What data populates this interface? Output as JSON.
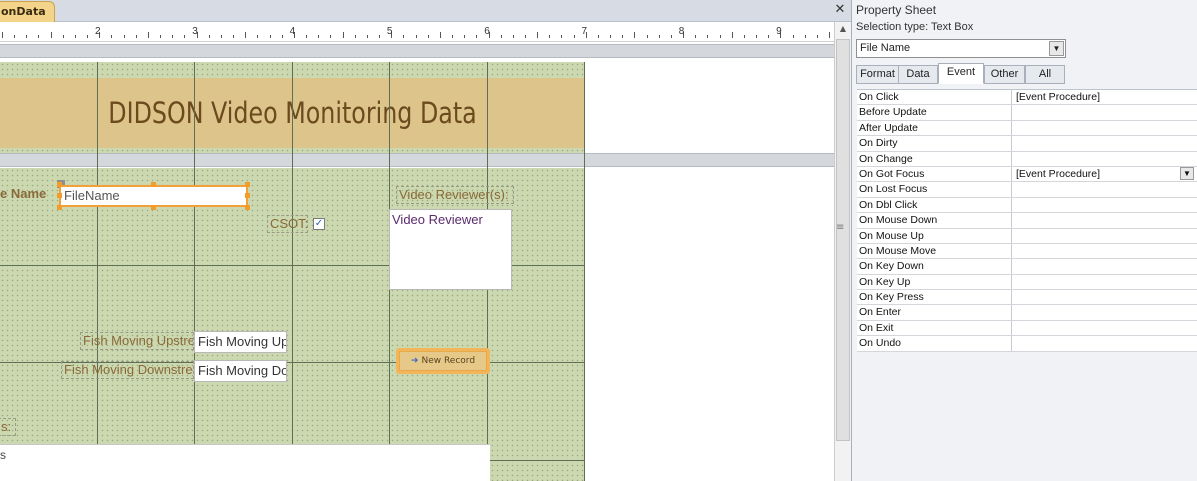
{
  "document_tab": {
    "label": "onData"
  },
  "ruler": {
    "numbers": [
      "2",
      "3",
      "4",
      "5",
      "6",
      "7",
      "8",
      "9"
    ]
  },
  "form": {
    "title": "DIDSON Video Monitoring Data",
    "labels": {
      "file_name": "e Name",
      "csot": "CSOT:",
      "video_reviewer": "Video Reviewer(s):",
      "fish_upstream": "Fish Moving Upstre",
      "fish_downstream": "Fish Moving Downstre",
      "notes": "s:"
    },
    "fields": {
      "file_name": "FileName",
      "video_reviewer": "Video Reviewer",
      "fish_upstream": "Fish Moving Up",
      "fish_downstream": "Fish Moving Do",
      "notes": "s"
    },
    "csot_checked": true,
    "new_record_button": "New Record"
  },
  "property_sheet": {
    "title": "Property Sheet",
    "selection_type": "Selection type:  Text Box",
    "selected_object": "File Name",
    "tabs": [
      "Format",
      "Data",
      "Event",
      "Other",
      "All"
    ],
    "active_tab": "Event",
    "properties": [
      {
        "name": "On Click",
        "value": "[Event Procedure]"
      },
      {
        "name": "Before Update",
        "value": ""
      },
      {
        "name": "After Update",
        "value": ""
      },
      {
        "name": "On Dirty",
        "value": ""
      },
      {
        "name": "On Change",
        "value": ""
      },
      {
        "name": "On Got Focus",
        "value": "[Event Procedure]"
      },
      {
        "name": "On Lost Focus",
        "value": ""
      },
      {
        "name": "On Dbl Click",
        "value": ""
      },
      {
        "name": "On Mouse Down",
        "value": ""
      },
      {
        "name": "On Mouse Up",
        "value": ""
      },
      {
        "name": "On Mouse Move",
        "value": ""
      },
      {
        "name": "On Key Down",
        "value": ""
      },
      {
        "name": "On Key Up",
        "value": ""
      },
      {
        "name": "On Key Press",
        "value": ""
      },
      {
        "name": "On Enter",
        "value": ""
      },
      {
        "name": "On Exit",
        "value": ""
      },
      {
        "name": "On Undo",
        "value": ""
      }
    ]
  },
  "colors": {
    "header_band": "#dcc48a",
    "detail_grid": "#cbd8b0",
    "title_text": "#6b4a1e",
    "label_text": "#8a6a3a",
    "selection_handle": "#f29c2a"
  }
}
